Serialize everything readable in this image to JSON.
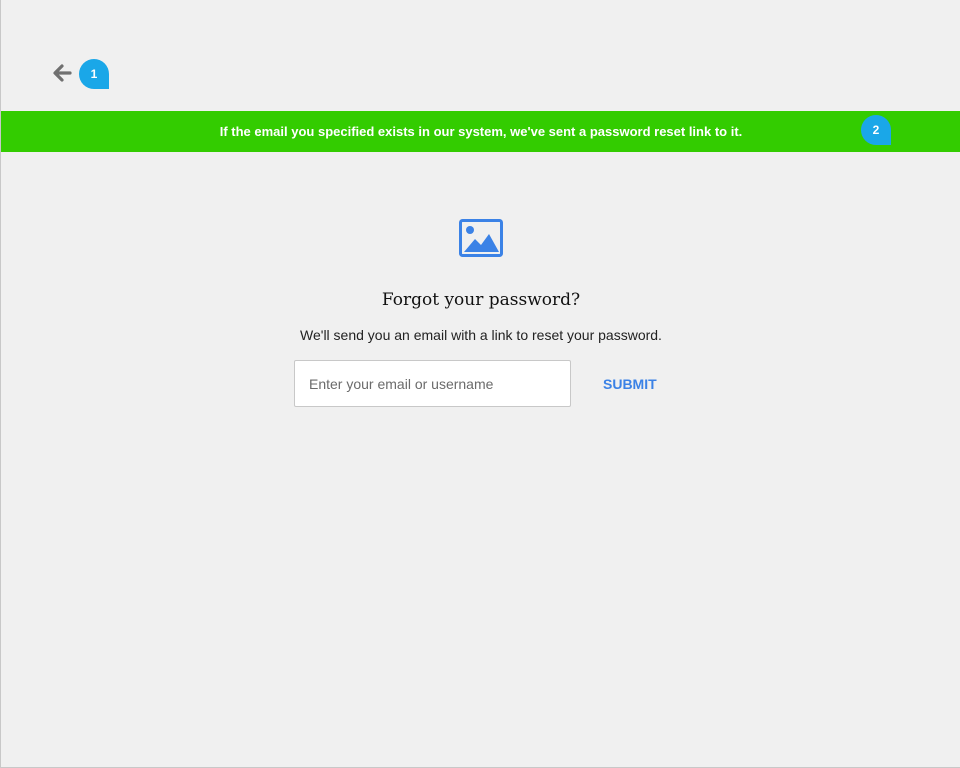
{
  "nav": {
    "back_icon": "arrow-left-icon"
  },
  "annotations": {
    "marker_1": "1",
    "marker_2": "2"
  },
  "banner": {
    "message": "If the email you specified exists in our system, we've sent a password reset link to it.",
    "color": "#33cc00"
  },
  "logo": {
    "icon": "image-placeholder-icon",
    "color": "#3b82e6"
  },
  "form": {
    "title": "Forgot your password?",
    "subtitle": "We'll send you an email with a link to reset your password.",
    "email_placeholder": "Enter your email or username",
    "email_value": "",
    "submit_label": "SUBMIT"
  },
  "colors": {
    "background": "#f0f0f0",
    "accent": "#3b82e6",
    "marker": "#1aa7e8"
  }
}
